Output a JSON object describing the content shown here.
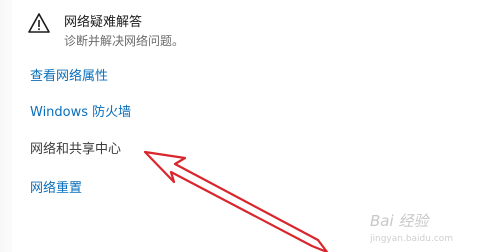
{
  "troubleshoot": {
    "title": "网络疑难解答",
    "subtitle": "诊断并解决网络问题。",
    "icon": "warning-triangle-icon"
  },
  "links": [
    {
      "label": "查看网络属性"
    },
    {
      "label": "Windows 防火墙"
    },
    {
      "label": "网络和共享中心"
    },
    {
      "label": "网络重置"
    }
  ],
  "annotation": {
    "arrow_color": "#d9262d",
    "icon": "red-arrow-icon"
  },
  "watermark": {
    "text": "Bai 经验",
    "subtext": "jingyan.baidu.com"
  },
  "colors": {
    "link": "#0a6fbb",
    "link_plain": "#3c3c3c"
  }
}
